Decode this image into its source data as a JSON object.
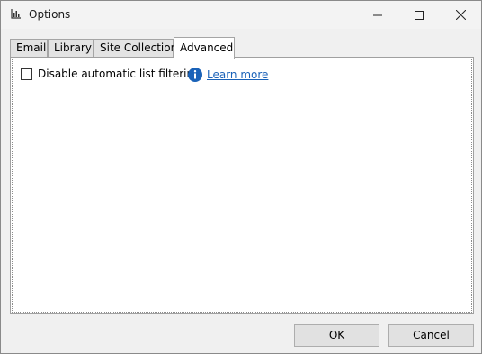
{
  "window": {
    "title": "Options",
    "app_icon": "chart-icon"
  },
  "titlebar_controls": {
    "minimize": "minimize-icon",
    "maximize": "maximize-icon",
    "close": "close-icon"
  },
  "tabs": [
    {
      "label": "Email",
      "active": false
    },
    {
      "label": "Library",
      "active": false
    },
    {
      "label": "Site Collection",
      "active": false
    },
    {
      "label": "Advanced",
      "active": true
    }
  ],
  "advanced": {
    "disable_filtering_label": "Disable automatic list filtering",
    "disable_filtering_checked": false,
    "info_icon": "info-icon",
    "learn_more": "Learn more"
  },
  "buttons": {
    "ok": "OK",
    "cancel": "Cancel"
  },
  "colors": {
    "link": "#1a62b8",
    "info_icon": "#1a62b8"
  }
}
